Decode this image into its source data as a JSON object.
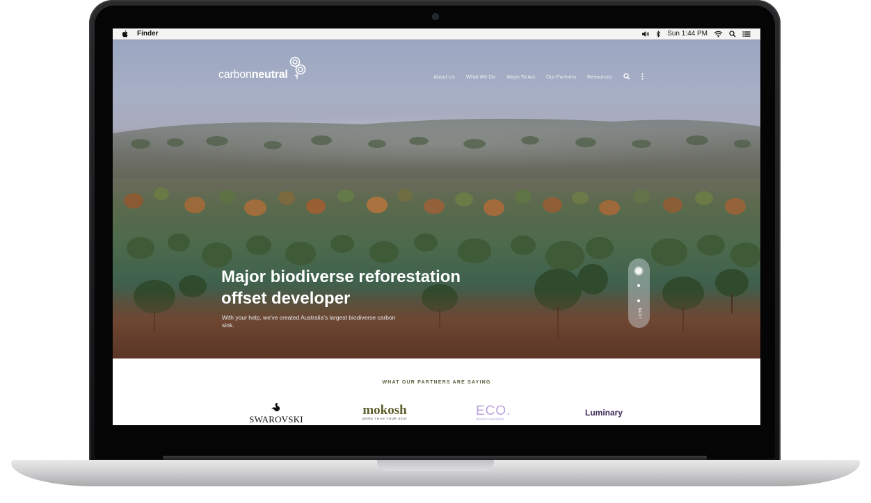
{
  "menubar": {
    "app_name": "Finder",
    "clock": "Sun 1:44 PM"
  },
  "site": {
    "logo_light": "carbon",
    "logo_bold": "neutral",
    "nav": [
      "About Us",
      "What We Do",
      "Ways To Act",
      "Our Partners",
      "Resources"
    ]
  },
  "hero": {
    "headline_line1": "Major biodiverse reforestation",
    "headline_line2": "offset developer",
    "subtext": "With your help, we've created Australia's largest biodiverse carbon sink.",
    "slider_next": "NEXT",
    "slider_total": 3,
    "slider_active": 1
  },
  "partners": {
    "heading": "WHAT OUR PARTNERS ARE SAYING",
    "logos": {
      "swarovski": "SWAROVSKI",
      "mokosh": "mokosh",
      "mokosh_tagline": "MORE THAN YOUR SKIN",
      "eco": "ECO.",
      "eco_tagline": "Modern essentials",
      "luminary": "Luminary"
    }
  },
  "colors": {
    "headline": "#ffffff",
    "partners_heading": "#55623a",
    "mokosh": "#5b5e2c",
    "eco": "#b9a3dd",
    "luminary": "#3a2b55"
  }
}
